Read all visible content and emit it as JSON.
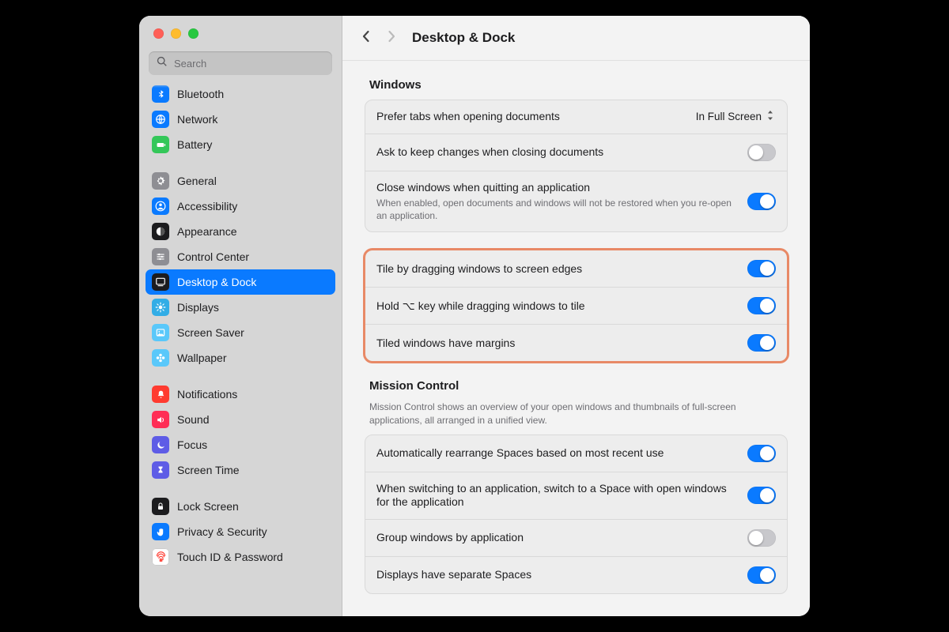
{
  "colors": {
    "accent": "#0a7aff",
    "highlight_border": "#e88966"
  },
  "header": {
    "title": "Desktop & Dock"
  },
  "search": {
    "placeholder": "Search"
  },
  "sidebar": {
    "items": [
      {
        "id": "bluetooth",
        "label": "Bluetooth",
        "icon_bg": "#0a7aff",
        "glyph": "bt"
      },
      {
        "id": "network",
        "label": "Network",
        "icon_bg": "#0a7aff",
        "glyph": "globe"
      },
      {
        "id": "battery",
        "label": "Battery",
        "icon_bg": "#34c759",
        "glyph": "battery"
      },
      {
        "id": "general",
        "label": "General",
        "icon_bg": "#8e8e93",
        "glyph": "gear"
      },
      {
        "id": "accessibility",
        "label": "Accessibility",
        "icon_bg": "#0a7aff",
        "glyph": "person"
      },
      {
        "id": "appearance",
        "label": "Appearance",
        "icon_bg": "#1c1c1e",
        "glyph": "contrast"
      },
      {
        "id": "control-center",
        "label": "Control Center",
        "icon_bg": "#8e8e93",
        "glyph": "sliders"
      },
      {
        "id": "desktop-dock",
        "label": "Desktop & Dock",
        "icon_bg": "#1c1c1e",
        "glyph": "dock",
        "selected": true
      },
      {
        "id": "displays",
        "label": "Displays",
        "icon_bg": "#32ade6",
        "glyph": "sun"
      },
      {
        "id": "screen-saver",
        "label": "Screen Saver",
        "icon_bg": "#5ac8fa",
        "glyph": "photo"
      },
      {
        "id": "wallpaper",
        "label": "Wallpaper",
        "icon_bg": "#5ac8fa",
        "glyph": "flower"
      },
      {
        "id": "notifications",
        "label": "Notifications",
        "icon_bg": "#ff3b30",
        "glyph": "bell"
      },
      {
        "id": "sound",
        "label": "Sound",
        "icon_bg": "#ff2d55",
        "glyph": "speaker"
      },
      {
        "id": "focus",
        "label": "Focus",
        "icon_bg": "#5e5ce6",
        "glyph": "moon"
      },
      {
        "id": "screen-time",
        "label": "Screen Time",
        "icon_bg": "#5e5ce6",
        "glyph": "hourglass"
      },
      {
        "id": "lock-screen",
        "label": "Lock Screen",
        "icon_bg": "#1c1c1e",
        "glyph": "lock"
      },
      {
        "id": "privacy",
        "label": "Privacy & Security",
        "icon_bg": "#0a7aff",
        "glyph": "hand"
      },
      {
        "id": "touch-id",
        "label": "Touch ID & Password",
        "icon_bg": "#ffffff",
        "glyph": "fingerprint",
        "glyph_color": "#ff3b30"
      }
    ],
    "group_breaks_after": [
      2,
      10,
      14
    ]
  },
  "sections": {
    "windows": {
      "heading": "Windows",
      "prefer_tabs": {
        "label": "Prefer tabs when opening documents",
        "value": "In Full Screen"
      },
      "ask_keep_changes": {
        "label": "Ask to keep changes when closing documents",
        "value": false
      },
      "close_on_quit": {
        "label": "Close windows when quitting an application",
        "sublabel": "When enabled, open documents and windows will not be restored when you re-open an application.",
        "value": true
      },
      "tile_edges": {
        "label": "Tile by dragging windows to screen edges",
        "value": true
      },
      "tile_option": {
        "label": "Hold ⌥ key while dragging windows to tile",
        "value": true
      },
      "tile_margins": {
        "label": "Tiled windows have margins",
        "value": true
      }
    },
    "mission_control": {
      "heading": "Mission Control",
      "description": "Mission Control shows an overview of your open windows and thumbnails of full-screen applications, all arranged in a unified view.",
      "auto_rearrange": {
        "label": "Automatically rearrange Spaces based on most recent use",
        "value": true
      },
      "switch_to_space": {
        "label": "When switching to an application, switch to a Space with open windows for the application",
        "value": true
      },
      "group_by_app": {
        "label": "Group windows by application",
        "value": false
      },
      "separate_displays": {
        "label": "Displays have separate Spaces",
        "value": true
      }
    }
  }
}
